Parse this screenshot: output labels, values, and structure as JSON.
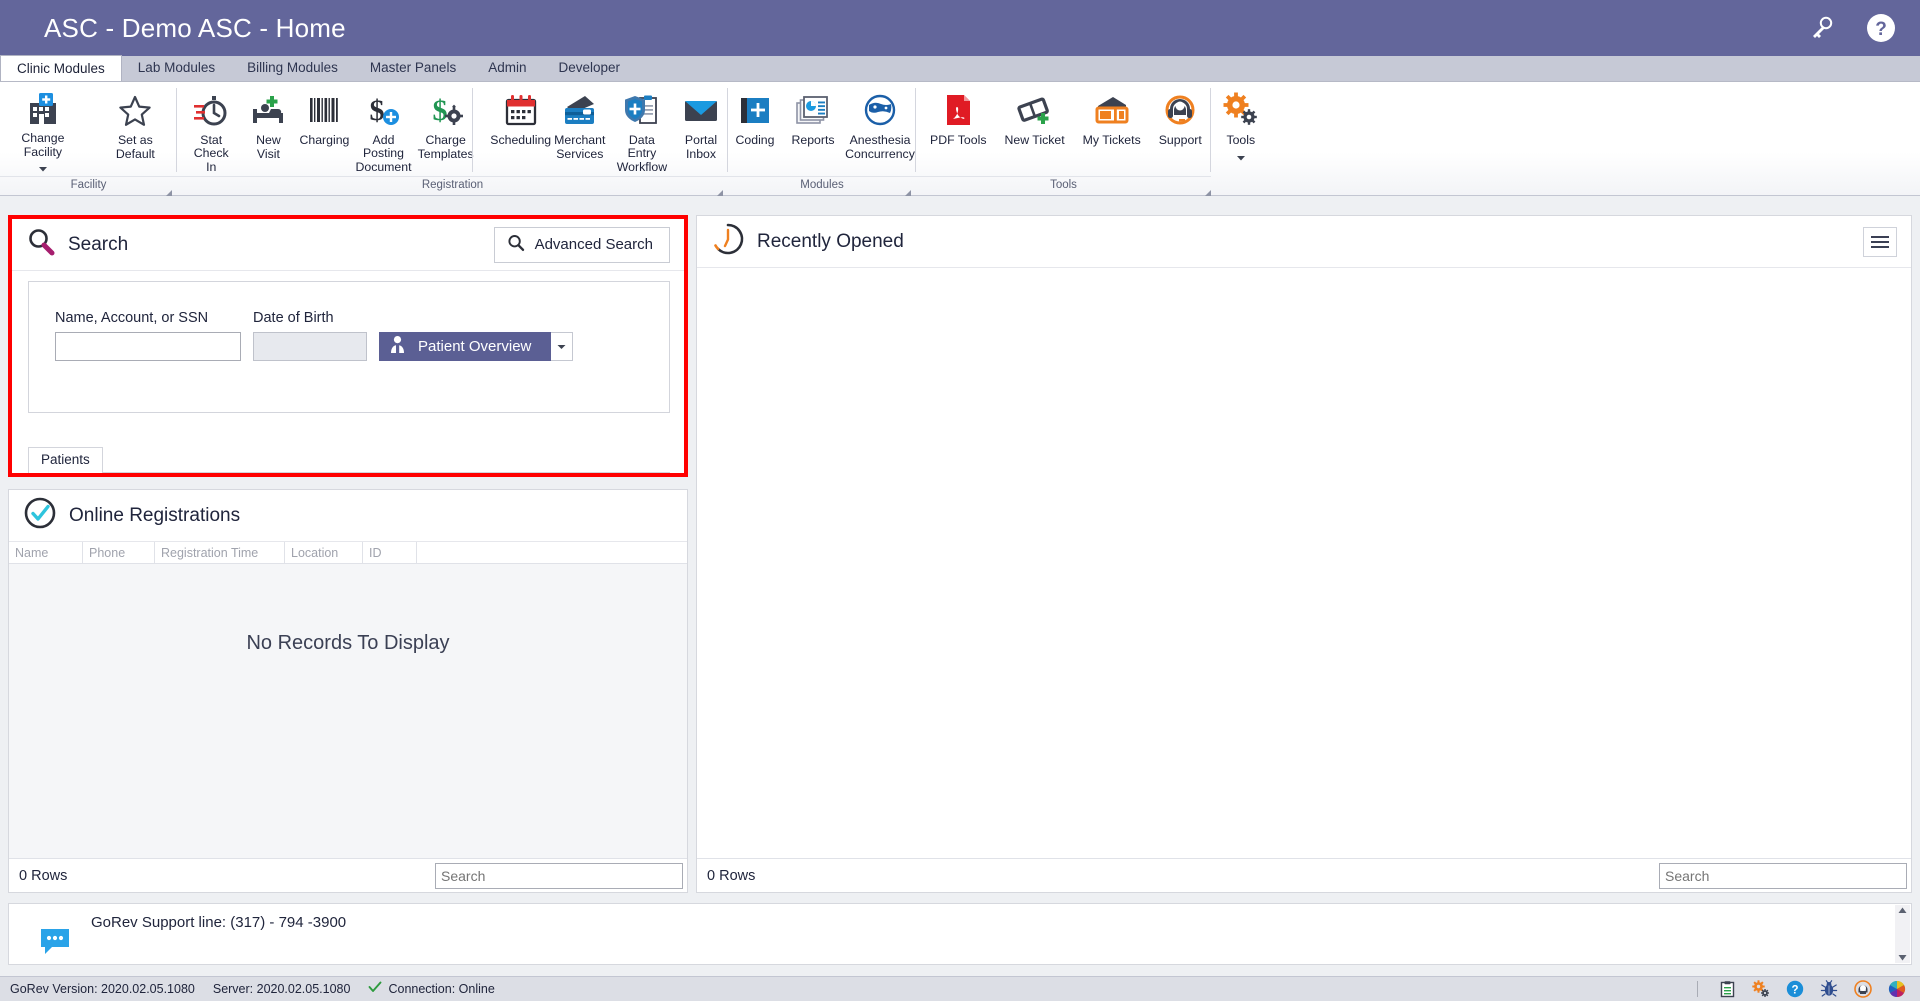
{
  "window": {
    "title": "ASC - Demo ASC - Home",
    "icons": [
      {
        "name": "keys-icon",
        "glyph": "keys"
      },
      {
        "name": "help-icon",
        "glyph": "question-circle"
      }
    ]
  },
  "ribbon": {
    "tabs": [
      {
        "label": "Clinic Modules",
        "active": true
      },
      {
        "label": "Lab Modules",
        "active": false
      },
      {
        "label": "Billing Modules",
        "active": false
      },
      {
        "label": "Master Panels",
        "active": false
      },
      {
        "label": "Admin",
        "active": false
      },
      {
        "label": "Developer",
        "active": false
      }
    ],
    "groups": [
      {
        "label": "Facility",
        "buttons": [
          {
            "label": "Change Facility",
            "icon": "hospital-icon",
            "has_caret": true
          },
          {
            "label": "Set as Default",
            "icon": "star-icon",
            "has_caret": false
          }
        ]
      },
      {
        "label": "Registration",
        "buttons": [
          {
            "label": "Stat Check In",
            "icon": "stopwatch-icon",
            "has_caret": false
          },
          {
            "label": "New Visit",
            "icon": "hospital-bed-icon",
            "has_caret": false
          },
          {
            "label": "Charging",
            "icon": "barcode-icon",
            "has_caret": false
          },
          {
            "label": "Add Posting Document",
            "icon": "dollar-plus-icon",
            "has_caret": false
          },
          {
            "label": "Charge Templates",
            "icon": "dollar-gear-icon",
            "has_caret": false
          },
          {
            "label": "Scheduling",
            "icon": "calendar-icon",
            "has_caret": false
          },
          {
            "label": "Merchant Services",
            "icon": "credit-card-icon",
            "has_caret": false
          },
          {
            "label": "Data Entry Workflow",
            "icon": "clipboard-shield-icon",
            "has_caret": false
          },
          {
            "label": "Portal Inbox",
            "icon": "envelope-icon",
            "has_caret": false
          }
        ]
      },
      {
        "label": "Modules",
        "buttons": [
          {
            "label": "Coding",
            "icon": "book-plus-icon",
            "has_caret": false
          },
          {
            "label": "Reports",
            "icon": "reports-icon",
            "has_caret": false
          },
          {
            "label": "Anesthesia Concurrency",
            "icon": "anesthesia-globe-icon",
            "has_caret": false
          }
        ]
      },
      {
        "label": "Tools",
        "buttons": [
          {
            "label": "PDF Tools",
            "icon": "pdf-icon",
            "has_caret": false
          },
          {
            "label": "New Ticket",
            "icon": "ticket-plus-icon",
            "has_caret": false
          },
          {
            "label": "My Tickets",
            "icon": "tickets-icon",
            "has_caret": false
          },
          {
            "label": "Support",
            "icon": "headset-icon",
            "has_caret": false
          },
          {
            "label": "Tools",
            "icon": "gears-icon",
            "has_caret": true
          }
        ]
      }
    ]
  },
  "search_panel": {
    "title": "Search",
    "icon": "search-magnifier-icon",
    "advanced_search_label": "Advanced Search",
    "name_field": {
      "label": "Name, Account, or SSN",
      "value": "",
      "placeholder": ""
    },
    "dob_field": {
      "label": "Date of Birth",
      "value": "",
      "placeholder": "",
      "disabled": true
    },
    "patient_overview_button": "Patient Overview",
    "tab_label": "Patients",
    "highlight_color": "#ff0000",
    "accent_color": "#5b5f94"
  },
  "online_registrations": {
    "title": "Online Registrations",
    "icon": "check-circle-icon",
    "columns": [
      "Name",
      "Phone",
      "Registration Time",
      "Location",
      "ID"
    ],
    "rows": [],
    "empty_message": "No Records To Display",
    "row_count_label": "0 Rows",
    "search_placeholder": "Search"
  },
  "recently_opened": {
    "title": "Recently Opened",
    "icon": "clock-icon",
    "menu_icon": "hamburger-menu-icon",
    "rows": [],
    "row_count_label": "0 Rows",
    "search_placeholder": "Search"
  },
  "support_strip": {
    "icon": "chat-bubble-icon",
    "text": "GoRev Support line: (317) - 794 -3900"
  },
  "statusbar": {
    "version_label": "GoRev Version: 2020.02.05.1080",
    "server_label": "Server: 2020.02.05.1080",
    "connection_label": "Connection: Online",
    "connection_ok_color": "#2e9b3f",
    "icons": [
      {
        "name": "clipboard-list-icon"
      },
      {
        "name": "gears-status-icon"
      },
      {
        "name": "help-status-icon"
      },
      {
        "name": "bug-icon"
      },
      {
        "name": "headset-status-icon"
      },
      {
        "name": "color-wheel-icon"
      }
    ]
  }
}
